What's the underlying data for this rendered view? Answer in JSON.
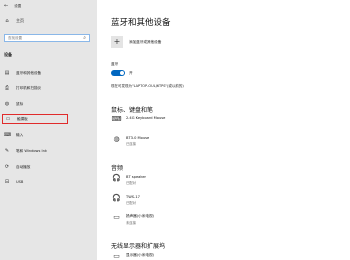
{
  "window": {
    "back_icon": "back-arrow-icon",
    "title": "设置"
  },
  "nav": {
    "home": {
      "icon": "home-icon",
      "label": "主页"
    },
    "search": {
      "placeholder": "查找设置",
      "icon": "search-icon"
    },
    "section": "设备",
    "items": [
      {
        "icon": "bluetooth-devices-icon",
        "label": "蓝牙和其他设备"
      },
      {
        "icon": "printer-icon",
        "label": "打印机和扫描仪"
      },
      {
        "icon": "mouse-icon",
        "label": "鼠标"
      },
      {
        "icon": "touchpad-icon",
        "label": "触摸板"
      },
      {
        "icon": "keyboard-icon",
        "label": "输入"
      },
      {
        "icon": "pen-icon",
        "label": "笔和 Windows Ink"
      },
      {
        "icon": "autoplay-icon",
        "label": "自动播放"
      },
      {
        "icon": "usb-icon",
        "label": "USB"
      }
    ],
    "active_index": 3,
    "active_border_color": "#e02b2b"
  },
  "main": {
    "title": "蓝牙和其他设备",
    "add_device": "添加蓝牙或其他设备",
    "bluetooth": {
      "label": "蓝牙",
      "toggle_state": "开",
      "discoverable_text": "现在可发现为\"LAPTOP-OULJ6TPS\"(或以前的)",
      "accent": "#0067c0"
    },
    "groups": [
      {
        "title": "鼠标、键盘和笔",
        "devices": [
          {
            "icon": "keyboard-device-icon",
            "name": "2.4G Keyboard Mouse",
            "status": ""
          },
          {
            "icon": "mouse-device-icon",
            "name": "BT3.0 Mouse",
            "status": "已连接"
          }
        ]
      },
      {
        "title": "音频",
        "devices": [
          {
            "icon": "headphones-icon",
            "name": "BT speaker",
            "status": "已配对"
          },
          {
            "icon": "headphones-icon",
            "name": "TWS-17",
            "status": "已配对"
          },
          {
            "icon": "speaker-icon",
            "name": "扬声器(小米电视)",
            "status": "未连接"
          }
        ]
      },
      {
        "title": "无线显示器和扩展坞",
        "devices": [
          {
            "icon": "display-icon",
            "name": "显示器(小米电视)",
            "status": ""
          }
        ]
      }
    ]
  }
}
